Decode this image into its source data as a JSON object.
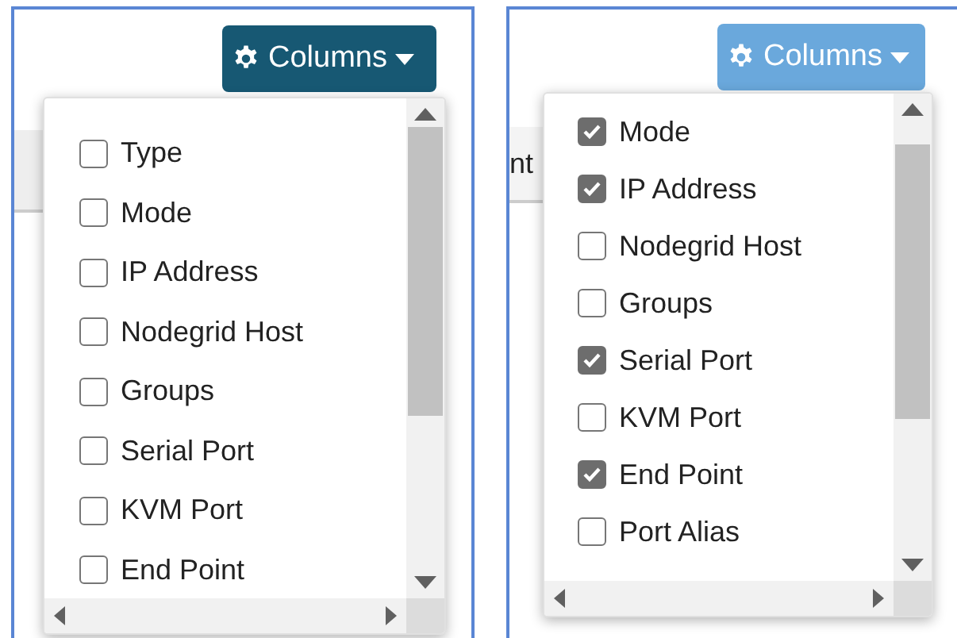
{
  "panels": [
    {
      "button": {
        "label": "Columns",
        "hovered": true
      },
      "items": [
        {
          "label": "Type",
          "checked": false
        },
        {
          "label": "Mode",
          "checked": false
        },
        {
          "label": "IP Address",
          "checked": false
        },
        {
          "label": "Nodegrid Host",
          "checked": false
        },
        {
          "label": "Groups",
          "checked": false
        },
        {
          "label": "Serial Port",
          "checked": false
        },
        {
          "label": "KVM Port",
          "checked": false
        },
        {
          "label": "End Point",
          "checked": false
        }
      ]
    },
    {
      "button": {
        "label": "Columns",
        "hovered": false
      },
      "table_header": "nt",
      "items": [
        {
          "label": "Mode",
          "checked": true
        },
        {
          "label": "IP Address",
          "checked": true
        },
        {
          "label": "Nodegrid Host",
          "checked": false
        },
        {
          "label": "Groups",
          "checked": false
        },
        {
          "label": "Serial Port",
          "checked": true
        },
        {
          "label": "KVM Port",
          "checked": false
        },
        {
          "label": "End Point",
          "checked": true
        },
        {
          "label": "Port Alias",
          "checked": false
        }
      ]
    }
  ]
}
